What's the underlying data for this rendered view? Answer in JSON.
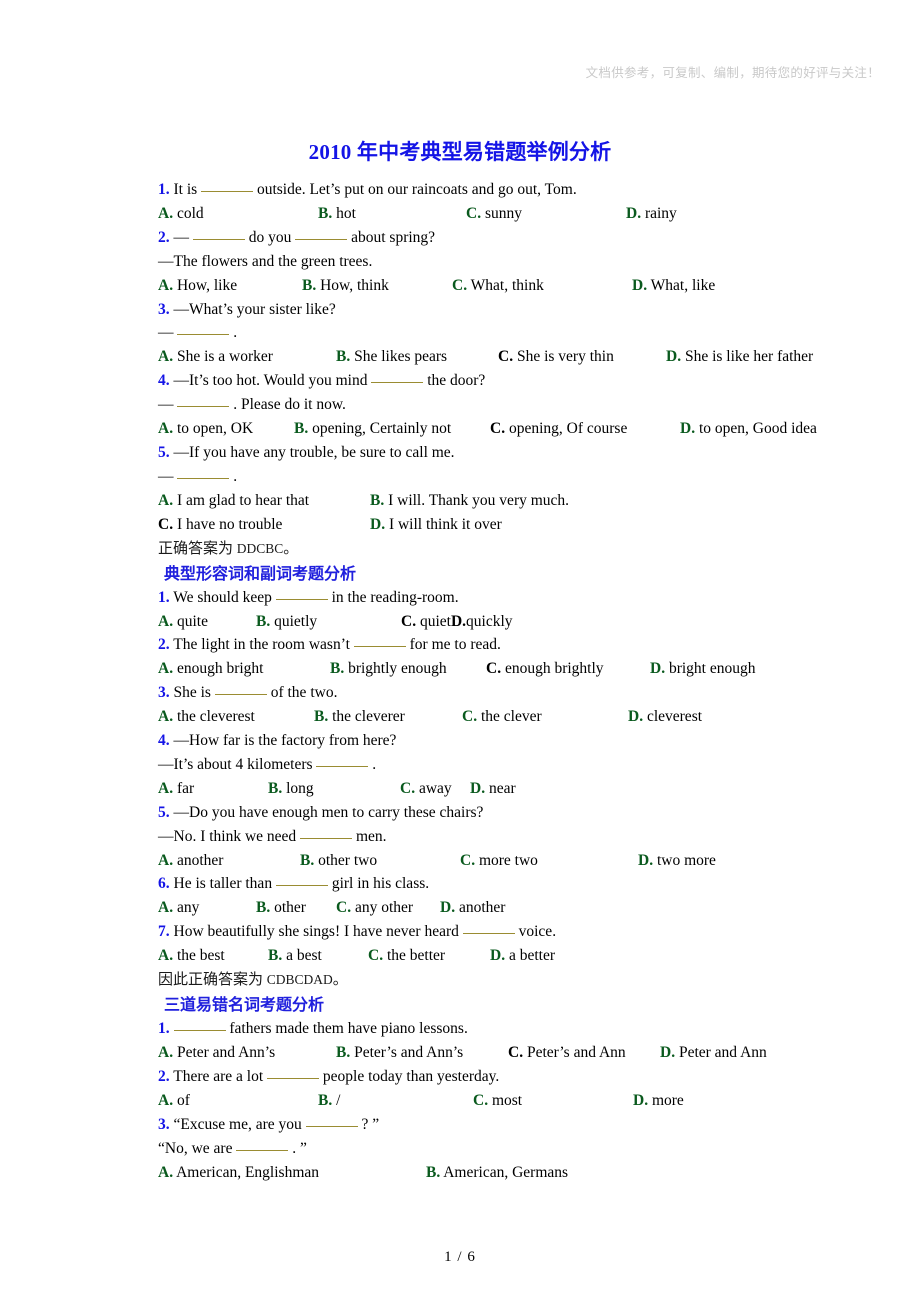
{
  "watermark": "文档供参考，可复制、编制，期待您的好评与关注！",
  "title": "2010 年中考典型易错题举例分析",
  "footer": "1 / 6",
  "colors": {
    "title_blue": "#1414e6",
    "question_number_blue": "#1414e6",
    "option_letter_green": "#0a5a1e",
    "section_heading_blue": "#2020dd",
    "blank_rule_olive": "#9a8c32",
    "watermark_gray": "#c9c9c9"
  },
  "sections": [
    {
      "id": "section-1",
      "heading": null,
      "questions": [
        {
          "num": "1.",
          "stem_parts": [
            "It is ",
            "BLANK",
            " outside. Let’s put on our raincoats and go out, Tom."
          ],
          "stem": "It is ______ outside. Let’s put on our raincoats and go out, Tom.",
          "extra_lines": [],
          "options": [
            {
              "letter": "A.",
              "text": " cold",
              "green": true
            },
            {
              "letter": "B.",
              "text": " hot",
              "green": true
            },
            {
              "letter": "C.",
              "text": " sunny",
              "green": true
            },
            {
              "letter": "D.",
              "text": " rainy",
              "green": true
            }
          ]
        },
        {
          "num": "2.",
          "stem": "—______ do you ______ about spring?",
          "extra_lines": [
            "—The flowers and the green trees."
          ],
          "options": [
            {
              "letter": "A.",
              "text": " How, like",
              "green": true
            },
            {
              "letter": "B.",
              "text": " How, think",
              "green": true
            },
            {
              "letter": "C.",
              "text": " What, think",
              "green": true
            },
            {
              "letter": "D.",
              "text": " What, like",
              "green": true
            }
          ]
        },
        {
          "num": "3.",
          "stem": "—What’s your sister like?",
          "extra_lines": [
            "—______."
          ],
          "options": [
            {
              "letter": "A.",
              "text": " She is a worker",
              "green": true
            },
            {
              "letter": "B.",
              "text": " She likes pears",
              "green": true
            },
            {
              "letter": "C.",
              "text": " She is very thin",
              "green": false
            },
            {
              "letter": "D.",
              "text": " She is like her father",
              "green": true
            }
          ]
        },
        {
          "num": "4.",
          "stem": "—It’s too hot. Would you mind ______ the door?",
          "extra_lines": [
            "—______. Please do it now."
          ],
          "options": [
            {
              "letter": "A.",
              "text": " to open, OK",
              "green": true
            },
            {
              "letter": "B.",
              "text": " opening, Certainly not",
              "green": true
            },
            {
              "letter": "C.",
              "text": " opening, Of course",
              "green": false
            },
            {
              "letter": "D.",
              "text": " to open, Good idea",
              "green": true
            }
          ]
        },
        {
          "num": "5.",
          "stem": "—If you have any trouble, be sure to call me.",
          "extra_lines": [
            "—______."
          ],
          "options": [
            {
              "letter": "A.",
              "text": " I am glad to hear that",
              "green": true
            },
            {
              "letter": "B.",
              "text": " I will. Thank you very much.",
              "green": true
            },
            {
              "letter": "C.",
              "text": " I have no trouble",
              "green": false
            },
            {
              "letter": "D.",
              "text": " I will think it over",
              "green": true
            }
          ]
        }
      ],
      "answer_line": {
        "prefix": "正确答案为 ",
        "code": "DDCBC",
        "suffix": "。"
      }
    },
    {
      "id": "section-2",
      "heading": "典型形容词和副词考题分析",
      "questions": [
        {
          "num": "1.",
          "stem": "We should keep ______ in the reading-room.",
          "extra_lines": [],
          "options": [
            {
              "letter": "A.",
              "text": " quite",
              "green": true
            },
            {
              "letter": "B.",
              "text": " quietly",
              "green": true
            },
            {
              "letter": "C.",
              "text": " quiet",
              "green": false
            },
            {
              "letter": "D.",
              "text": "quickly",
              "green": false
            }
          ]
        },
        {
          "num": "2.",
          "stem": "The light in the room wasn’t ______ for me to read.",
          "extra_lines": [],
          "options": [
            {
              "letter": "A.",
              "text": " enough bright",
              "green": true
            },
            {
              "letter": "B.",
              "text": " brightly enough",
              "green": true
            },
            {
              "letter": "C.",
              "text": " enough brightly",
              "green": false
            },
            {
              "letter": "D.",
              "text": " bright enough",
              "green": true
            }
          ]
        },
        {
          "num": "3.",
          "stem": "She is ______ of the two.",
          "extra_lines": [],
          "options": [
            {
              "letter": "A.",
              "text": " the cleverest",
              "green": true
            },
            {
              "letter": "B.",
              "text": " the cleverer",
              "green": true
            },
            {
              "letter": "C.",
              "text": " the clever",
              "green": true
            },
            {
              "letter": "D.",
              "text": " cleverest",
              "green": true
            }
          ]
        },
        {
          "num": "4.",
          "stem": "—How far is the factory from here?",
          "extra_lines": [
            "—It’s about 4 kilometers ______."
          ],
          "options": [
            {
              "letter": "A.",
              "text": " far",
              "green": true
            },
            {
              "letter": "B.",
              "text": " long",
              "green": true
            },
            {
              "letter": "C.",
              "text": " away",
              "green": true
            },
            {
              "letter": "D.",
              "text": " near",
              "green": true
            }
          ]
        },
        {
          "num": "5.",
          "stem": "—Do you have enough men to carry these chairs?",
          "extra_lines": [
            "—No. I think we need ______ men."
          ],
          "options": [
            {
              "letter": "A.",
              "text": " another",
              "green": true
            },
            {
              "letter": "B.",
              "text": " other two",
              "green": true
            },
            {
              "letter": "C.",
              "text": " more two",
              "green": true
            },
            {
              "letter": "D.",
              "text": " two more",
              "green": true
            }
          ]
        },
        {
          "num": "6.",
          "stem": "He is taller than ______ girl in his class.",
          "extra_lines": [],
          "options": [
            {
              "letter": "A.",
              "text": " any",
              "green": true
            },
            {
              "letter": "B.",
              "text": " other",
              "green": true
            },
            {
              "letter": "C.",
              "text": " any other",
              "green": true
            },
            {
              "letter": "D.",
              "text": " another",
              "green": true
            }
          ]
        },
        {
          "num": "7.",
          "stem": "How beautifully she sings! I have never heard ______ voice.",
          "extra_lines": [],
          "options": [
            {
              "letter": "A.",
              "text": " the best",
              "green": true
            },
            {
              "letter": "B.",
              "text": " a best",
              "green": true
            },
            {
              "letter": "C.",
              "text": " the better",
              "green": true
            },
            {
              "letter": "D.",
              "text": " a better",
              "green": true
            }
          ]
        }
      ],
      "answer_line": {
        "prefix": "因此正确答案为 ",
        "code": "CDBCDAD",
        "suffix": "。"
      }
    },
    {
      "id": "section-3",
      "heading": "三道易错名词考题分析",
      "questions": [
        {
          "num": "1.",
          "stem": "______ fathers made them have piano lessons.",
          "extra_lines": [],
          "options": [
            {
              "letter": "A.",
              "text": " Peter and Ann’s",
              "green": true
            },
            {
              "letter": "B.",
              "text": " Peter’s and Ann’s",
              "green": true
            },
            {
              "letter": "C.",
              "text": " Peter’s and Ann",
              "green": false
            },
            {
              "letter": "D.",
              "text": " Peter and Ann",
              "green": true
            }
          ]
        },
        {
          "num": "2.",
          "stem": "There are a lot ______ people today than yesterday.",
          "extra_lines": [],
          "options": [
            {
              "letter": "A.",
              "text": " of",
              "green": true
            },
            {
              "letter": "B.",
              "text": " /",
              "green": true
            },
            {
              "letter": "C.",
              "text": " most",
              "green": true
            },
            {
              "letter": "D.",
              "text": " more",
              "green": true
            }
          ]
        },
        {
          "num": "3.",
          "stem": "“Excuse me, are you ______? ”",
          "extra_lines": [
            "“No, we are ______. ”"
          ],
          "options": [
            {
              "letter": "A.",
              "text": " American, Englishman",
              "green": true
            },
            {
              "letter": "B.",
              "text": " American, Germans",
              "green": true
            }
          ]
        }
      ],
      "answer_line": null
    }
  ],
  "lines": [
    {
      "k": "q",
      "num": "1.",
      "a": "It is ",
      "blank": "b-md",
      "b": " outside. Let’s put on our raincoats and go out, Tom."
    },
    {
      "k": "o4",
      "cols": [
        160,
        148,
        160,
        0
      ],
      "o": [
        {
          "l": "A.",
          "t": " cold",
          "g": true
        },
        {
          "l": "B.",
          "t": " hot",
          "g": true
        },
        {
          "l": "C.",
          "t": " sunny",
          "g": true
        },
        {
          "l": "D.",
          "t": " rainy",
          "g": true
        }
      ]
    },
    {
      "k": "q2",
      "num": "2.",
      "a": "—",
      "blank": "b-md",
      "b": " do you ",
      "blank2": "b-md",
      "c": " about spring?"
    },
    {
      "k": "p",
      "t": "—The flowers and the green trees."
    },
    {
      "k": "o4",
      "cols": [
        144,
        150,
        180,
        0
      ],
      "o": [
        {
          "l": "A.",
          "t": " How, like",
          "g": true
        },
        {
          "l": "B.",
          "t": " How, think",
          "g": true
        },
        {
          "l": "C.",
          "t": " What, think",
          "g": true
        },
        {
          "l": "D.",
          "t": " What, like",
          "g": true
        }
      ]
    },
    {
      "k": "q",
      "num": "3.",
      "a": "—What’s your sister like?",
      "blank": null,
      "b": ""
    },
    {
      "k": "dash",
      "blank": "b-md",
      "tail": "."
    },
    {
      "k": "o4",
      "cols": [
        178,
        162,
        168,
        0
      ],
      "o": [
        {
          "l": "A.",
          "t": " She is a worker",
          "g": true
        },
        {
          "l": "B.",
          "t": " She likes pears",
          "g": true
        },
        {
          "l": "C.",
          "t": " She is very thin",
          "g": false
        },
        {
          "l": "D.",
          "t": " She is like her father",
          "g": true
        }
      ]
    },
    {
      "k": "q",
      "num": "4.",
      "a": "—It’s too hot. Would you mind ",
      "blank": "b-md",
      "b": " the door?"
    },
    {
      "k": "dash2",
      "blank": "b-md",
      "tail": ". Please do it now."
    },
    {
      "k": "o4",
      "cols": [
        136,
        196,
        190,
        0
      ],
      "o": [
        {
          "l": "A.",
          "t": " to open, OK",
          "g": true
        },
        {
          "l": "B.",
          "t": " opening, Certainly not",
          "g": true
        },
        {
          "l": "C.",
          "t": " opening, Of course",
          "g": false
        },
        {
          "l": "D.",
          "t": " to open, Good idea",
          "g": true
        }
      ]
    },
    {
      "k": "q",
      "num": "5.",
      "a": "—If you have any trouble, be sure to call me.",
      "blank": null,
      "b": ""
    },
    {
      "k": "dash",
      "blank": "b-md",
      "tail": "."
    },
    {
      "k": "o2",
      "cols": [
        210,
        0
      ],
      "o": [
        {
          "l": "A.",
          "t": " I am glad to hear that",
          "g": true
        },
        {
          "l": "B.",
          "t": " I will. Thank you very much.",
          "g": true
        }
      ]
    },
    {
      "k": "o2",
      "cols": [
        210,
        0
      ],
      "o": [
        {
          "l": "C.",
          "t": " I have no trouble",
          "g": false
        },
        {
          "l": "D.",
          "t": " I will think it over",
          "g": true
        }
      ]
    }
  ]
}
